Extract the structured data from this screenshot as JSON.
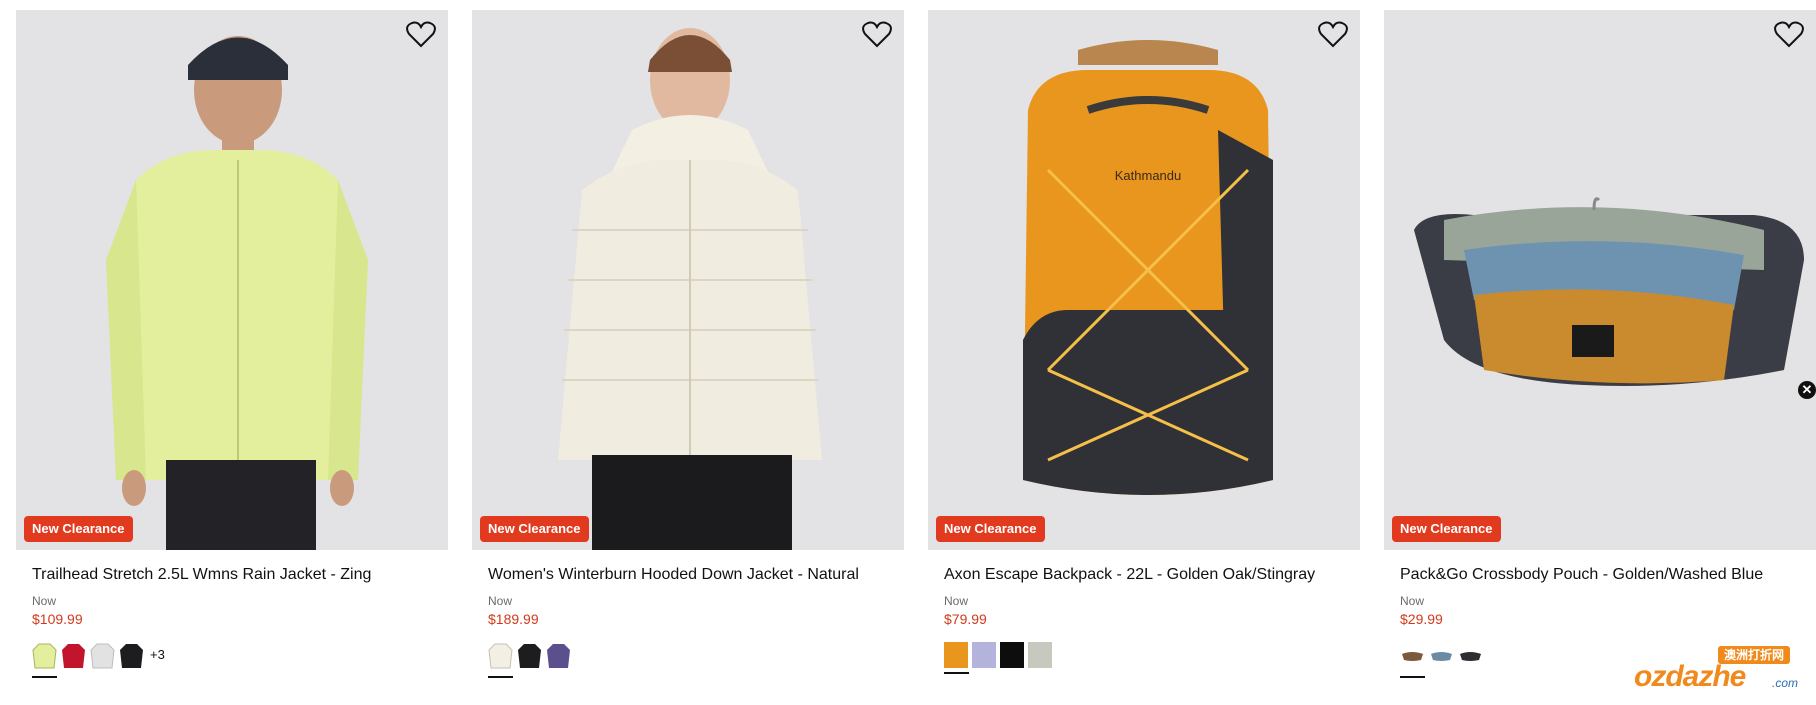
{
  "badge_label": "New Clearance",
  "now_label": "Now",
  "products": [
    {
      "title": "Trailhead Stretch 2.5L Wmns Rain Jacket - Zing",
      "price": "$109.99",
      "more_colors": "+3"
    },
    {
      "title": "Women's Winterburn Hooded Down Jacket - Natural",
      "price": "$189.99"
    },
    {
      "title": "Axon Escape Backpack - 22L - Golden Oak/Stingray",
      "price": "$79.99"
    },
    {
      "title": "Pack&Go Crossbody Pouch - Golden/Washed Blue",
      "price": "$29.99"
    }
  ],
  "colors": {
    "badge": "#e23a1f",
    "price": "#d03a1b",
    "image_bg": "#e3e2e4"
  },
  "icons": [
    "heart-icon",
    "close-icon"
  ],
  "watermark": {
    "top": "澳洲打折网",
    "text": "ozdazhe",
    "suffix": ".com"
  }
}
